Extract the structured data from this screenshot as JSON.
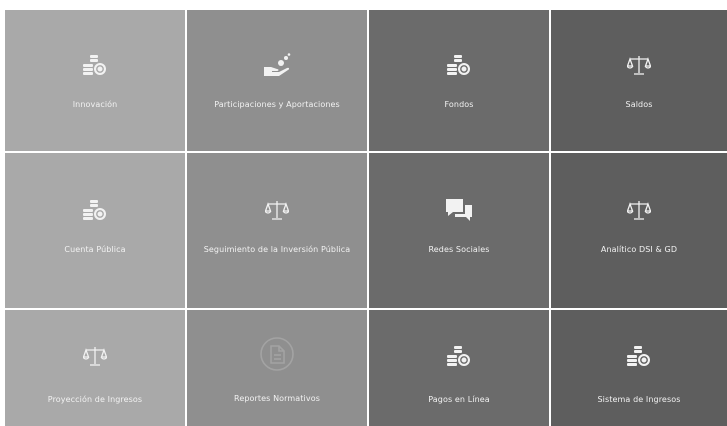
{
  "tiles": [
    {
      "label": "Innovación",
      "icon": "coins-icon",
      "color": "#a9a9a9"
    },
    {
      "label": "Participaciones y Aportaciones",
      "icon": "hand-coins-icon",
      "color": "#8f8f8f"
    },
    {
      "label": "Fondos",
      "icon": "coins-icon",
      "color": "#6b6b6b"
    },
    {
      "label": "Saldos",
      "icon": "scale-icon",
      "color": "#5e5e5e"
    },
    {
      "label": "Cuenta Pública",
      "icon": "coins-icon",
      "color": "#a9a9a9"
    },
    {
      "label": "Seguimiento de la Inversión Pública",
      "icon": "scale-icon",
      "color": "#8f8f8f"
    },
    {
      "label": "Redes Sociales",
      "icon": "chat-bubbles-icon",
      "color": "#6b6b6b"
    },
    {
      "label": "Analítico DSI & GD",
      "icon": "scale-icon",
      "color": "#5e5e5e"
    },
    {
      "label": "Proyección de Ingresos",
      "icon": "scale-icon",
      "color": "#a9a9a9"
    },
    {
      "label": "Reportes Normativos",
      "icon": "document-circle-icon",
      "color": "#8f8f8f"
    },
    {
      "label": "Pagos en Línea",
      "icon": "coins-icon",
      "color": "#6b6b6b"
    },
    {
      "label": "Sistema de Ingresos",
      "icon": "coins-icon",
      "color": "#5e5e5e"
    }
  ]
}
